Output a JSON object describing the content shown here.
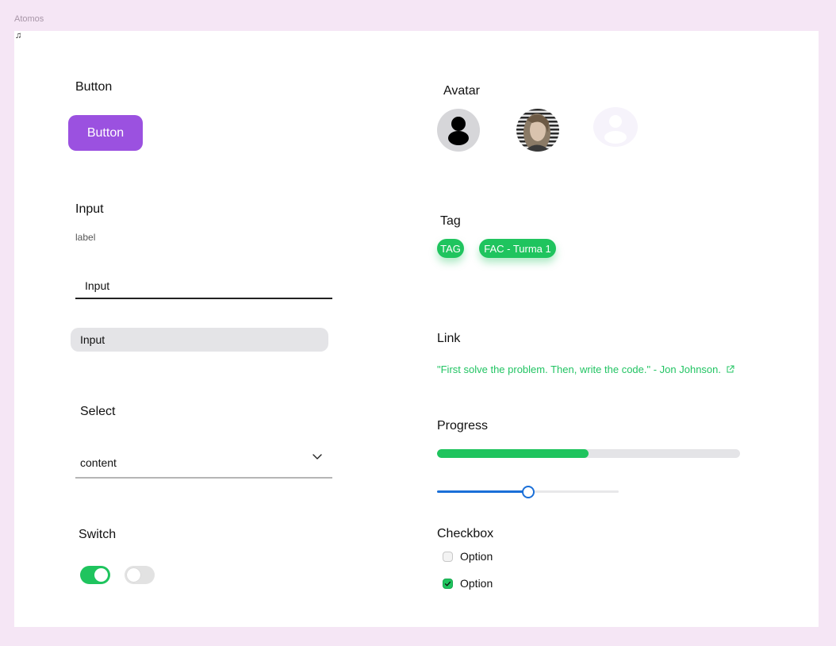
{
  "frame": {
    "title": "Atomos",
    "note_glyph": "♫"
  },
  "button_section": {
    "heading": "Button",
    "button_label": "Button"
  },
  "input_section": {
    "heading": "Input",
    "label": "label",
    "underline_placeholder": "Input",
    "filled_placeholder": "Input"
  },
  "select_section": {
    "heading": "Select",
    "value": "content"
  },
  "switch_section": {
    "heading": "Switch",
    "switches": [
      {
        "on": true
      },
      {
        "on": false
      }
    ]
  },
  "avatar_section": {
    "heading": "Avatar",
    "avatars": [
      "user-silhouette-icon",
      "user-photo",
      "placeholder-avatar-icon"
    ]
  },
  "tag_section": {
    "heading": "Tag",
    "tags": [
      "TAG",
      "FAC - Turma 1"
    ]
  },
  "link_section": {
    "heading": "Link",
    "text": "\"First solve the problem. Then, write the code.\" - Jon Johnson.",
    "icon": "external-link-icon"
  },
  "progress_section": {
    "heading": "Progress",
    "progress_percent": 50,
    "slider_percent": 50
  },
  "checkbox_section": {
    "heading": "Checkbox",
    "options": [
      {
        "label": "Option",
        "checked": false
      },
      {
        "label": "Option",
        "checked": true
      }
    ]
  },
  "colors": {
    "background": "#f5e6f5",
    "primary_purple": "#9b51e0",
    "accent_green": "#1fc45e",
    "slider_blue": "#1a6fd8"
  }
}
